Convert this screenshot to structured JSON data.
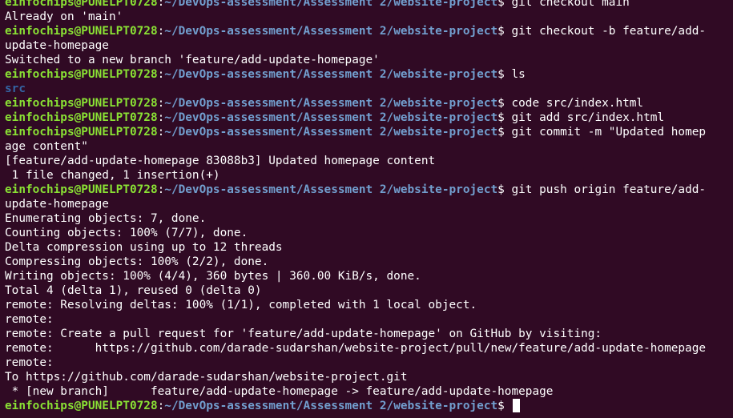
{
  "colors": {
    "background": "#300a24",
    "prompt_user": "#8ae234",
    "prompt_path": "#729fcf",
    "directory": "#3465a4",
    "text": "#ffffff"
  },
  "prompt": {
    "user_host": "einfochips@PUNELPT0728",
    "separator": ":",
    "path": "~/DevOps-assessment/Assessment 2/website-project",
    "symbol": "$ "
  },
  "lines": [
    {
      "type": "prompt",
      "cmd": "git checkout main"
    },
    {
      "type": "output",
      "text": "Already on 'main'"
    },
    {
      "type": "prompt",
      "cmd": "git checkout -b feature/add-"
    },
    {
      "type": "output",
      "text": "update-homepage"
    },
    {
      "type": "output",
      "text": "Switched to a new branch 'feature/add-update-homepage'"
    },
    {
      "type": "prompt",
      "cmd": "ls"
    },
    {
      "type": "dir",
      "text": "src"
    },
    {
      "type": "prompt",
      "cmd": "code src/index.html"
    },
    {
      "type": "prompt",
      "cmd": "git add src/index.html"
    },
    {
      "type": "prompt",
      "cmd": "git commit -m \"Updated homep"
    },
    {
      "type": "output",
      "text": "age content\""
    },
    {
      "type": "output",
      "text": "[feature/add-update-homepage 83088b3] Updated homepage content"
    },
    {
      "type": "output",
      "text": " 1 file changed, 1 insertion(+)"
    },
    {
      "type": "prompt",
      "cmd": "git push origin feature/add-"
    },
    {
      "type": "output",
      "text": "update-homepage"
    },
    {
      "type": "output",
      "text": "Enumerating objects: 7, done."
    },
    {
      "type": "output",
      "text": "Counting objects: 100% (7/7), done."
    },
    {
      "type": "output",
      "text": "Delta compression using up to 12 threads"
    },
    {
      "type": "output",
      "text": "Compressing objects: 100% (2/2), done."
    },
    {
      "type": "output",
      "text": "Writing objects: 100% (4/4), 360 bytes | 360.00 KiB/s, done."
    },
    {
      "type": "output",
      "text": "Total 4 (delta 1), reused 0 (delta 0)"
    },
    {
      "type": "output",
      "text": "remote: Resolving deltas: 100% (1/1), completed with 1 local object."
    },
    {
      "type": "output",
      "text": "remote:"
    },
    {
      "type": "output",
      "text": "remote: Create a pull request for 'feature/add-update-homepage' on GitHub by visiting:"
    },
    {
      "type": "output",
      "text": "remote:      https://github.com/darade-sudarshan/website-project/pull/new/feature/add-update-homepage"
    },
    {
      "type": "output",
      "text": "remote:"
    },
    {
      "type": "output",
      "text": "To https://github.com/darade-sudarshan/website-project.git"
    },
    {
      "type": "output",
      "text": " * [new branch]      feature/add-update-homepage -> feature/add-update-homepage"
    },
    {
      "type": "prompt",
      "cmd": "",
      "cursor": true
    }
  ]
}
